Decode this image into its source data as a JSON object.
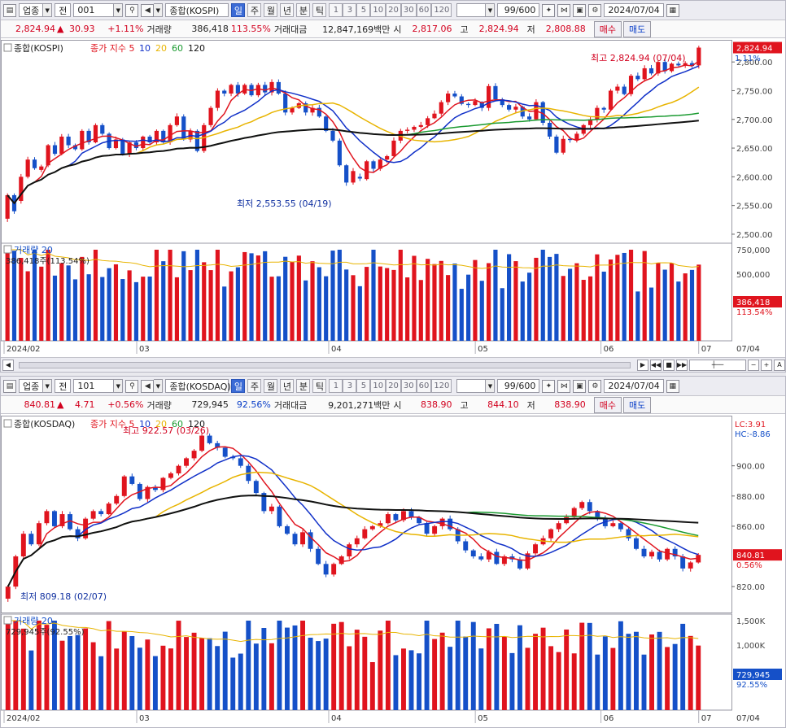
{
  "toolbar": {
    "category_label": "업종",
    "all_label": "전",
    "period_buttons": [
      "일",
      "주",
      "월",
      "년",
      "분",
      "틱"
    ],
    "num_buttons": [
      "1",
      "3",
      "5",
      "10",
      "20",
      "30",
      "60",
      "120"
    ],
    "count_display": "99/600",
    "date": "2024/07/04"
  },
  "panels": [
    {
      "code": "001",
      "index_name": "종합(KOSPI)",
      "price": "2,824.94",
      "change": "30.93",
      "change_pct": "+1.11%",
      "volume_label": "거래량",
      "volume": "386,418",
      "volume_pct": "113.55%",
      "value_label": "거래대금",
      "value": "12,847,169백만",
      "open_label": "시",
      "open": "2,817.06",
      "high_label": "고",
      "high": "2,824.94",
      "low_label": "저",
      "low": "2,808.88",
      "buy_label": "매수",
      "sell_label": "매도",
      "legend_title": "종합(KOSPI)",
      "legend_ma": "종가 지수 5",
      "ma_labels": [
        "10",
        "20",
        "60",
        "120"
      ],
      "right_top_labels": [
        "C:10.53",
        "1.11%"
      ],
      "price_tag": "2,824.94",
      "max_annotation": "최고 2,824.94 (07/04)",
      "min_annotation": "최저 2,553.55 (04/19)",
      "vol_legend": "거래량 20",
      "vol_value_text": "386,418주(113.54%)",
      "vol_tag": "386,418",
      "vol_pct_tag": "113.54%",
      "x_labels": [
        "2024/02",
        "03",
        "04",
        "05",
        "06",
        "07",
        "07/04"
      ],
      "y_ticks": [
        "2,800.00",
        "2,750.00",
        "2,700.00",
        "2,650.00",
        "2,600.00",
        "2,550.00",
        "2,500.00"
      ],
      "vol_ticks": [
        "750,000",
        "500,000"
      ]
    },
    {
      "code": "101",
      "index_name": "종합(KOSDAQ)",
      "price": "840.81",
      "change": "4.71",
      "change_pct": "+0.56%",
      "volume_label": "거래량",
      "volume": "729,945",
      "volume_pct": "92.56%",
      "value_label": "거래대금",
      "value": "9,201,271백만",
      "open_label": "시",
      "open": "838.90",
      "high_label": "고",
      "high": "844.10",
      "low_label": "저",
      "low": "838.90",
      "buy_label": "매수",
      "sell_label": "매도",
      "legend_title": "종합(KOSDAQ)",
      "legend_ma": "종가 지수 5",
      "ma_labels": [
        "10",
        "20",
        "60",
        "120"
      ],
      "right_top_labels": [
        "LC:3.91",
        "HC:-8.86"
      ],
      "price_tag": "840.81",
      "pct_tag": "0.56%",
      "max_annotation": "최고 922.57 (03/26)",
      "min_annotation": "최저 809.18 (02/07)",
      "vol_legend": "거래량 20",
      "vol_value_text": "729,945주(92.55%)",
      "vol_tag": "729,945",
      "vol_pct_tag": "92.55%",
      "x_labels": [
        "2024/02",
        "03",
        "04",
        "05",
        "06",
        "07",
        "07/04"
      ],
      "y_ticks": [
        "900.00",
        "880.00",
        "860.00",
        "820.00"
      ],
      "vol_ticks": [
        "1,500K",
        "1,000K"
      ]
    }
  ],
  "chart_data": [
    {
      "type": "candlestick",
      "title": "종합(KOSPI)",
      "ylim": [
        2490,
        2830
      ],
      "ma_periods": [
        5,
        10,
        20,
        60,
        120
      ],
      "ma_colors": [
        "#e0141e",
        "#1030c8",
        "#e8b400",
        "#1a9a30",
        "#111111"
      ],
      "candles": [
        [
          2527,
          2568
        ],
        [
          2568,
          2540
        ],
        [
          2558,
          2600
        ],
        [
          2600,
          2630
        ],
        [
          2630,
          2615
        ],
        [
          2612,
          2618
        ],
        [
          2620,
          2655
        ],
        [
          2655,
          2640
        ],
        [
          2640,
          2670
        ],
        [
          2670,
          2655
        ],
        [
          2655,
          2648
        ],
        [
          2648,
          2680
        ],
        [
          2680,
          2660
        ],
        [
          2660,
          2690
        ],
        [
          2690,
          2675
        ],
        [
          2675,
          2650
        ],
        [
          2650,
          2665
        ],
        [
          2665,
          2640
        ],
        [
          2640,
          2660
        ],
        [
          2660,
          2650
        ],
        [
          2650,
          2670
        ],
        [
          2670,
          2660
        ],
        [
          2660,
          2680
        ],
        [
          2680,
          2660
        ],
        [
          2660,
          2690
        ],
        [
          2690,
          2705
        ],
        [
          2705,
          2665
        ],
        [
          2665,
          2680
        ],
        [
          2680,
          2645
        ],
        [
          2645,
          2690
        ],
        [
          2690,
          2720
        ],
        [
          2720,
          2750
        ],
        [
          2750,
          2745
        ],
        [
          2745,
          2760
        ],
        [
          2760,
          2745
        ],
        [
          2745,
          2760
        ],
        [
          2760,
          2742
        ],
        [
          2742,
          2760
        ],
        [
          2760,
          2747
        ],
        [
          2747,
          2765
        ],
        [
          2765,
          2745
        ],
        [
          2745,
          2712
        ],
        [
          2712,
          2720
        ],
        [
          2720,
          2728
        ],
        [
          2728,
          2712
        ],
        [
          2712,
          2720
        ],
        [
          2720,
          2705
        ],
        [
          2705,
          2680
        ],
        [
          2680,
          2663
        ],
        [
          2663,
          2620
        ],
        [
          2620,
          2590
        ],
        [
          2590,
          2610
        ],
        [
          2600,
          2597
        ],
        [
          2596,
          2627
        ],
        [
          2627,
          2614
        ],
        [
          2614,
          2630
        ],
        [
          2630,
          2636
        ],
        [
          2636,
          2663
        ],
        [
          2663,
          2680
        ],
        [
          2680,
          2682
        ],
        [
          2682,
          2687
        ],
        [
          2687,
          2690
        ],
        [
          2690,
          2702
        ],
        [
          2702,
          2710
        ],
        [
          2710,
          2730
        ],
        [
          2730,
          2745
        ],
        [
          2745,
          2740
        ],
        [
          2740,
          2727
        ],
        [
          2727,
          2725
        ],
        [
          2725,
          2732
        ],
        [
          2730,
          2720
        ],
        [
          2720,
          2758
        ],
        [
          2758,
          2735
        ],
        [
          2735,
          2725
        ],
        [
          2725,
          2717
        ],
        [
          2717,
          2722
        ],
        [
          2722,
          2705
        ],
        [
          2705,
          2700
        ],
        [
          2700,
          2730
        ],
        [
          2730,
          2694
        ],
        [
          2694,
          2670
        ],
        [
          2670,
          2642
        ],
        [
          2642,
          2666
        ],
        [
          2666,
          2664
        ],
        [
          2664,
          2675
        ],
        [
          2675,
          2690
        ],
        [
          2690,
          2700
        ],
        [
          2700,
          2720
        ],
        [
          2720,
          2717
        ],
        [
          2717,
          2750
        ],
        [
          2750,
          2757
        ],
        [
          2757,
          2744
        ],
        [
          2744,
          2776
        ],
        [
          2776,
          2770
        ],
        [
          2770,
          2789
        ],
        [
          2789,
          2780
        ],
        [
          2780,
          2800
        ],
        [
          2800,
          2784
        ],
        [
          2784,
          2797
        ],
        [
          2797,
          2794
        ],
        [
          2794,
          2798
        ],
        [
          2798,
          2793
        ],
        [
          2794,
          2825
        ]
      ],
      "volume_max": 850000,
      "volume_ma_period": 20
    },
    {
      "type": "candlestick",
      "title": "종합(KOSDAQ)",
      "ylim": [
        805,
        930
      ],
      "ma_periods": [
        5,
        10,
        20,
        60,
        120
      ],
      "ma_colors": [
        "#e0141e",
        "#1030c8",
        "#e8b400",
        "#1a9a30",
        "#111111"
      ],
      "candles": [
        [
          812,
          820
        ],
        [
          820,
          840
        ],
        [
          840,
          855
        ],
        [
          855,
          848
        ],
        [
          848,
          862
        ],
        [
          862,
          870
        ],
        [
          870,
          860
        ],
        [
          860,
          868
        ],
        [
          868,
          858
        ],
        [
          858,
          852
        ],
        [
          852,
          865
        ],
        [
          865,
          870
        ],
        [
          870,
          868
        ],
        [
          868,
          875
        ],
        [
          875,
          880
        ],
        [
          880,
          893
        ],
        [
          893,
          888
        ],
        [
          888,
          878
        ],
        [
          878,
          886
        ],
        [
          886,
          884
        ],
        [
          884,
          892
        ],
        [
          892,
          895
        ],
        [
          895,
          900
        ],
        [
          900,
          905
        ],
        [
          905,
          910
        ],
        [
          910,
          920
        ],
        [
          920,
          915
        ],
        [
          915,
          912
        ],
        [
          912,
          906
        ],
        [
          906,
          905
        ],
        [
          905,
          900
        ],
        [
          900,
          890
        ],
        [
          890,
          882
        ],
        [
          882,
          870
        ],
        [
          870,
          873
        ],
        [
          873,
          860
        ],
        [
          860,
          855
        ],
        [
          855,
          848
        ],
        [
          848,
          856
        ],
        [
          856,
          845
        ],
        [
          845,
          835
        ],
        [
          835,
          828
        ],
        [
          828,
          835
        ],
        [
          835,
          840
        ],
        [
          840,
          848
        ],
        [
          848,
          852
        ],
        [
          852,
          858
        ],
        [
          858,
          860
        ],
        [
          860,
          862
        ],
        [
          862,
          868
        ],
        [
          868,
          864
        ],
        [
          864,
          870
        ],
        [
          870,
          866
        ],
        [
          866,
          862
        ],
        [
          862,
          855
        ],
        [
          855,
          860
        ],
        [
          860,
          865
        ],
        [
          865,
          858
        ],
        [
          858,
          850
        ],
        [
          850,
          844
        ],
        [
          844,
          840
        ],
        [
          840,
          838
        ],
        [
          838,
          843
        ],
        [
          843,
          835
        ],
        [
          835,
          840
        ],
        [
          840,
          838
        ],
        [
          838,
          832
        ],
        [
          832,
          842
        ],
        [
          842,
          848
        ],
        [
          848,
          852
        ],
        [
          852,
          858
        ],
        [
          858,
          862
        ],
        [
          862,
          866
        ],
        [
          866,
          872
        ],
        [
          872,
          876
        ],
        [
          876,
          870
        ],
        [
          870,
          865
        ],
        [
          865,
          860
        ],
        [
          860,
          862
        ],
        [
          862,
          858
        ],
        [
          858,
          852
        ],
        [
          852,
          845
        ],
        [
          845,
          840
        ],
        [
          840,
          843
        ],
        [
          843,
          838
        ],
        [
          838,
          845
        ],
        [
          845,
          840
        ],
        [
          840,
          832
        ],
        [
          832,
          836
        ],
        [
          836,
          841
        ]
      ],
      "volume_max": 1750,
      "volume_ma_period": 20
    }
  ]
}
